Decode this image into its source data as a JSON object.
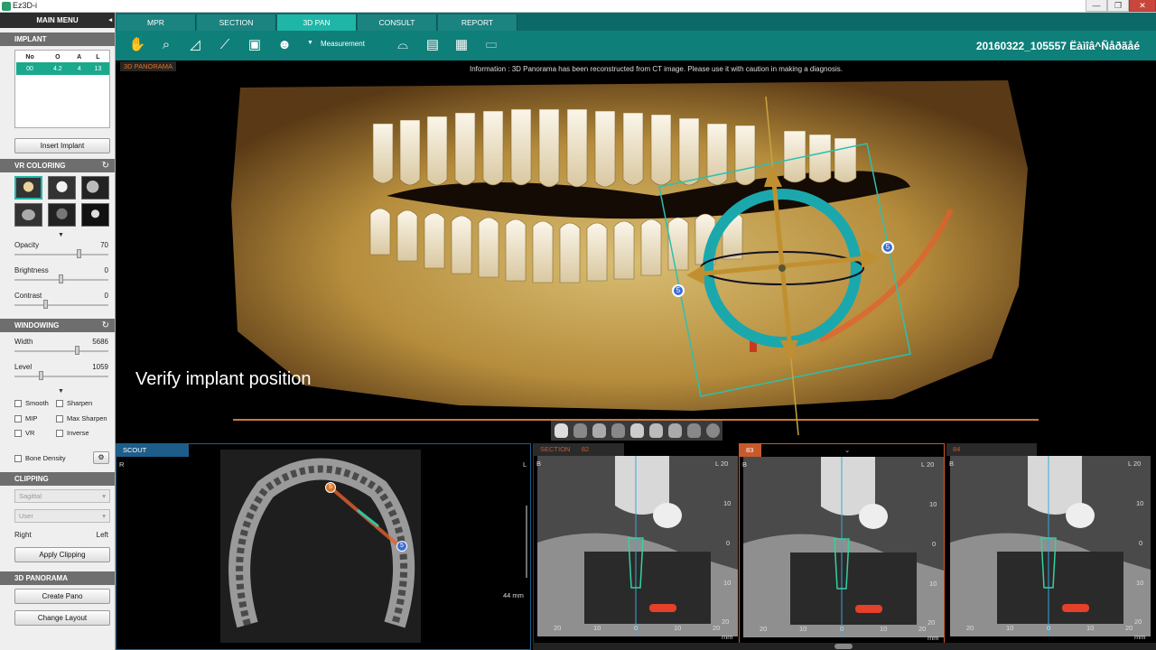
{
  "window": {
    "title": "Ez3D-i",
    "minimize": "—",
    "maximize": "❐",
    "close": "✕"
  },
  "left": {
    "main_menu": "MAIN MENU",
    "main_menu_icon": "collapse-arrow",
    "implant": {
      "header": "IMPLANT",
      "columns": [
        "No",
        "O",
        "A",
        "L"
      ],
      "rows": [
        [
          "00",
          "4.2",
          "4",
          "13"
        ]
      ],
      "insert_button": "Insert Implant"
    },
    "vr_coloring": {
      "header": "VR COLORING",
      "reset_icon": "refresh-icon",
      "presets": [
        "skull-bone-color",
        "skull-white",
        "skull-gray",
        "head-soft-tissue",
        "skull-dark",
        "skull-inverse"
      ]
    },
    "sliders": [
      {
        "label": "Opacity",
        "value": "70",
        "pos": 0.72
      },
      {
        "label": "Brightness",
        "value": "0",
        "pos": 0.5
      },
      {
        "label": "Contrast",
        "value": "0",
        "pos": 0.35
      }
    ],
    "windowing": {
      "header": "WINDOWING",
      "sliders": [
        {
          "label": "Width",
          "value": "5686",
          "pos": 0.68
        },
        {
          "label": "Level",
          "value": "1059",
          "pos": 0.28
        }
      ]
    },
    "checks": {
      "smooth": "Smooth",
      "sharpen": "Sharpen",
      "mip": "MIP",
      "max_sharpen": "Max Sharpen",
      "vr": "VR",
      "inverse": "Inverse",
      "bone_density": "Bone Density"
    },
    "clipping": {
      "header": "CLIPPING",
      "plane": "Sagittal",
      "mode": "User",
      "right": "Right",
      "left": "Left",
      "apply_button": "Apply Clipping"
    },
    "panorama": {
      "header": "3D PANORAMA",
      "create_button": "Create Pano",
      "change_button": "Change Layout"
    }
  },
  "tabs": [
    {
      "label": "MPR",
      "active": false
    },
    {
      "label": "SECTION",
      "active": false
    },
    {
      "label": "3D PAN",
      "active": true
    },
    {
      "label": "CONSULT",
      "active": false
    },
    {
      "label": "REPORT",
      "active": false
    }
  ],
  "toolbar": {
    "tools": [
      "hand-icon",
      "zoom-icon",
      "angle-icon",
      "ruler-icon",
      "camera-icon",
      "skull-settings-icon"
    ],
    "measurement": "Measurement",
    "extra_tools": [
      "panorama-curve-icon",
      "layout-icon",
      "grid-icon",
      "screen-icon"
    ],
    "patient_id": "20160322_105557 Ëàìîâ^Ñåðãåé"
  },
  "main": {
    "label": "3D PANORAMA",
    "info": "Information : 3D Panorama has been reconstructed from CT image. Please use it with caution in making a diagnosis.",
    "caption": "Verify implant position",
    "handle_labels": [
      "5",
      "5"
    ]
  },
  "scout": {
    "label": "SCOUT",
    "right": "R",
    "left": "L",
    "scale": "44 mm",
    "markers": [
      "5",
      "5"
    ]
  },
  "sections": {
    "label": "SECTION",
    "panels": [
      {
        "num": "82",
        "top": "B",
        "side": "L",
        "depth": "20"
      },
      {
        "num": "83",
        "top": "B",
        "side": "L",
        "depth": "20"
      },
      {
        "num": "84",
        "top": "B",
        "side": "L",
        "depth": "20"
      }
    ],
    "y_ticks": [
      "10",
      "0",
      "10",
      "20",
      "mm"
    ],
    "x_ticks": [
      "20",
      "10",
      "0",
      "10",
      "20",
      "mm"
    ]
  },
  "colors": {
    "accent": "#1fb6a8",
    "toolbar": "#0e7f79",
    "implant_ring": "#1aa8ad",
    "nerve": "#e4602c",
    "bone": "#c8a458",
    "panel_active": "#c75a2c"
  }
}
